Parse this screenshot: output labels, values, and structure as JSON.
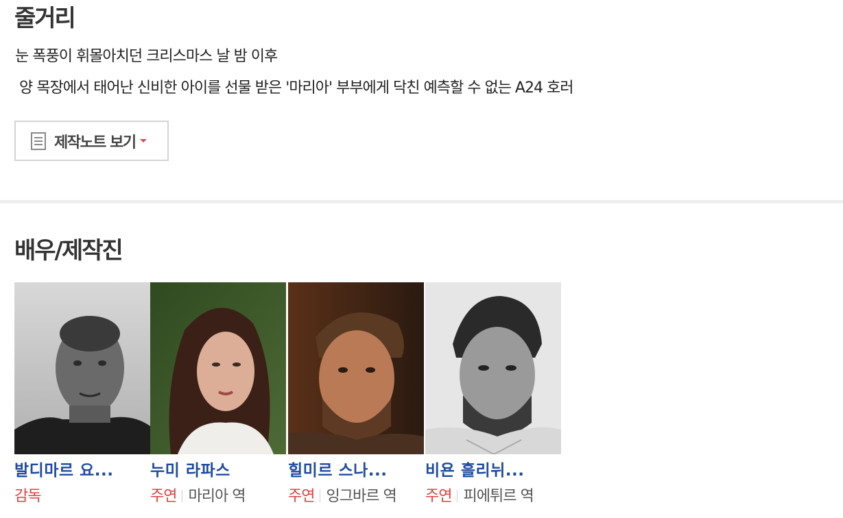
{
  "synopsis": {
    "title": "줄거리",
    "line1": "눈 폭풍이 휘몰아치던 크리스마스 날 밤 이후",
    "line2": " 양 목장에서 태어난 신비한 아이를 선물 받은 '마리아' 부부에게 닥친 예측할 수 없는 A24 호러"
  },
  "notes_button": {
    "label": "제작노트 보기",
    "icon": "document-icon",
    "caret": "caret-down-icon"
  },
  "cast": {
    "title": "배우/제작진",
    "members": [
      {
        "name": "발디마르 요...",
        "role_type": "감독",
        "character": ""
      },
      {
        "name": "누미 라파스",
        "role_type": "주연",
        "character": "마리아 역"
      },
      {
        "name": "힐미르 스나...",
        "role_type": "주연",
        "character": "잉그바르 역"
      },
      {
        "name": "비욘 흘리뉘...",
        "role_type": "주연",
        "character": "피에튀르 역"
      }
    ]
  },
  "colors": {
    "name_link": "#1e4aa0",
    "role_type": "#e14040",
    "divider": "#eeeeee"
  }
}
